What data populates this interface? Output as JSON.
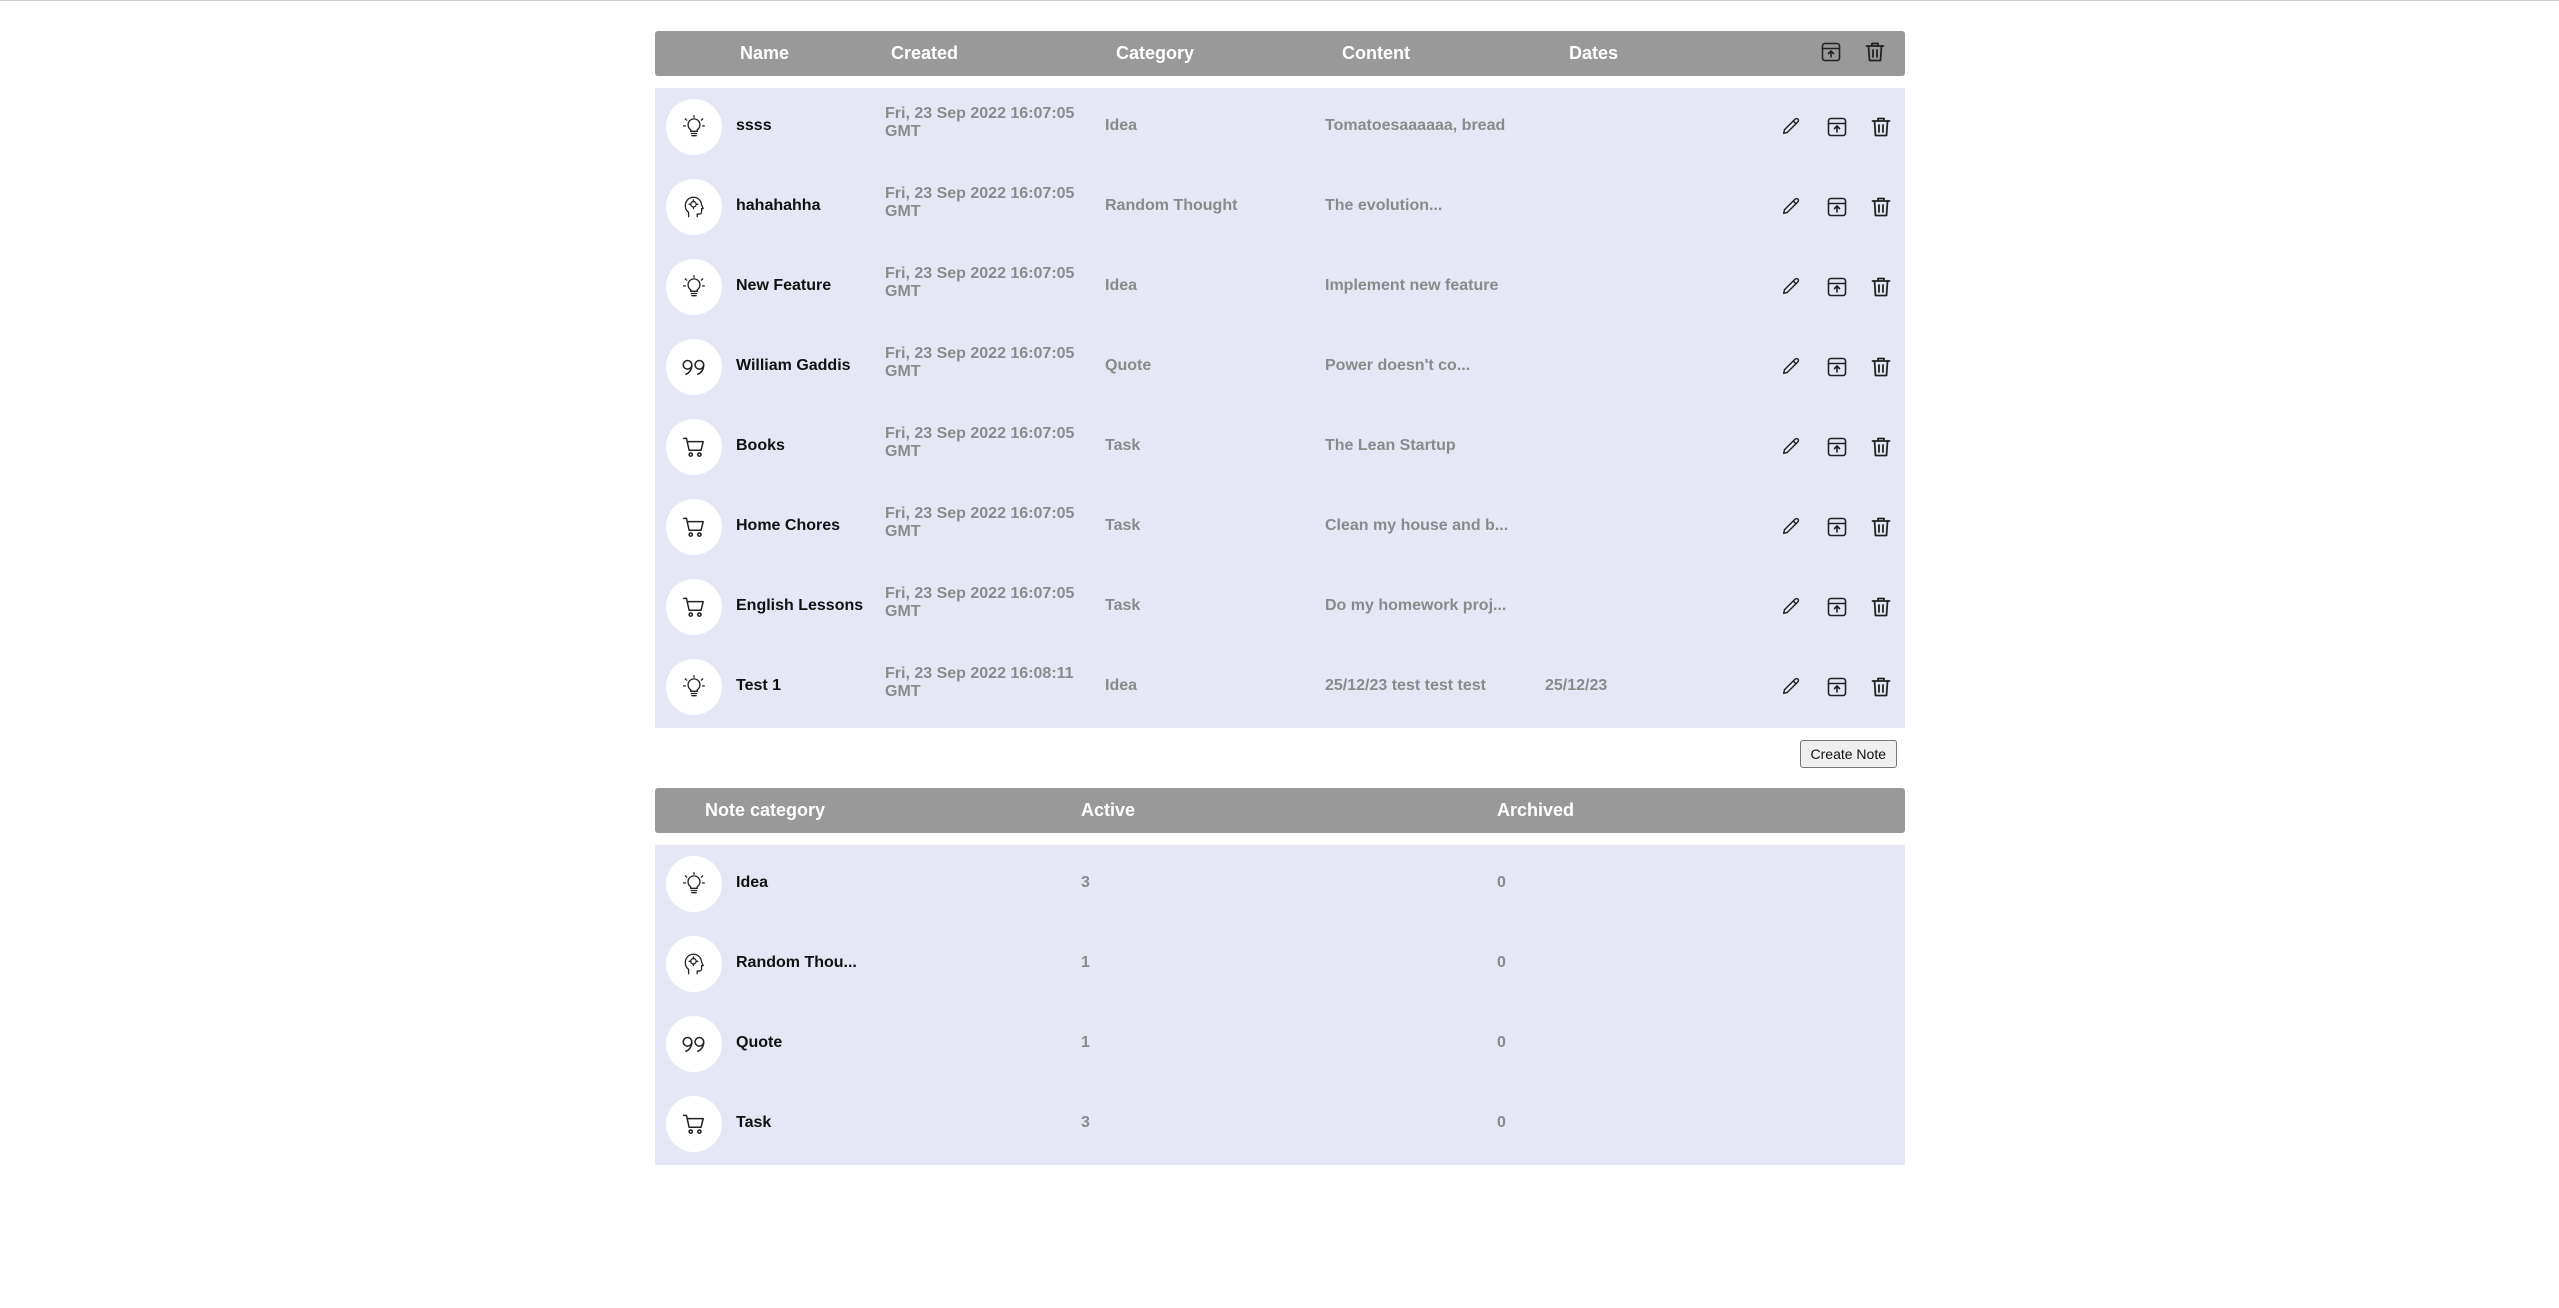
{
  "notes_table": {
    "headers": {
      "name": "Name",
      "created": "Created",
      "category": "Category",
      "content": "Content",
      "dates": "Dates"
    },
    "header_icons": [
      "archive-icon",
      "trash-icon"
    ],
    "rows": [
      {
        "icon": "lightbulb-icon",
        "name": "ssss",
        "created": "Fri, 23 Sep 2022 16:07:05 GMT",
        "category": "Idea",
        "content": "Tomatoesaaaaaa, bread",
        "dates": ""
      },
      {
        "icon": "head-icon",
        "name": "hahahahha",
        "created": "Fri, 23 Sep 2022 16:07:05 GMT",
        "category": "Random Thought",
        "content": "The evolution...",
        "dates": ""
      },
      {
        "icon": "lightbulb-icon",
        "name": "New Feature",
        "created": "Fri, 23 Sep 2022 16:07:05 GMT",
        "category": "Idea",
        "content": "Implement new feature",
        "dates": ""
      },
      {
        "icon": "quote-icon",
        "name": "William Gaddis",
        "created": "Fri, 23 Sep 2022 16:07:05 GMT",
        "category": "Quote",
        "content": "Power doesn't co...",
        "dates": ""
      },
      {
        "icon": "cart-icon",
        "name": "Books",
        "created": "Fri, 23 Sep 2022 16:07:05 GMT",
        "category": "Task",
        "content": "The Lean Startup",
        "dates": ""
      },
      {
        "icon": "cart-icon",
        "name": "Home Chores",
        "created": "Fri, 23 Sep 2022 16:07:05 GMT",
        "category": "Task",
        "content": "Clean my house and b...",
        "dates": ""
      },
      {
        "icon": "cart-icon",
        "name": "English Lessons",
        "created": "Fri, 23 Sep 2022 16:07:05 GMT",
        "category": "Task",
        "content": "Do my homework proj...",
        "dates": ""
      },
      {
        "icon": "lightbulb-icon",
        "name": "Test 1",
        "created": "Fri, 23 Sep 2022 16:08:11 GMT",
        "category": "Idea",
        "content": "25/12/23 test test test",
        "dates": "25/12/23"
      }
    ],
    "row_actions": [
      "edit-icon",
      "archive-icon",
      "trash-icon"
    ]
  },
  "create_note_label": "Create Note",
  "summary_table": {
    "headers": {
      "category": "Note category",
      "active": "Active",
      "archived": "Archived"
    },
    "rows": [
      {
        "icon": "lightbulb-icon",
        "category": "Idea",
        "active": "3",
        "archived": "0"
      },
      {
        "icon": "head-icon",
        "category": "Random Thou...",
        "active": "1",
        "archived": "0"
      },
      {
        "icon": "quote-icon",
        "category": "Quote",
        "active": "1",
        "archived": "0"
      },
      {
        "icon": "cart-icon",
        "category": "Task",
        "active": "3",
        "archived": "0"
      }
    ]
  }
}
